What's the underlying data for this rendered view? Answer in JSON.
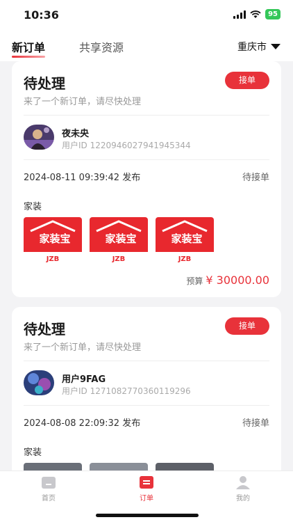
{
  "status_bar": {
    "time": "10:36",
    "battery": "95"
  },
  "header": {
    "tabs": [
      {
        "label": "新订单"
      },
      {
        "label": "共享资源"
      }
    ],
    "city": "重庆市"
  },
  "orders": [
    {
      "title": "待处理",
      "accept_label": "接单",
      "subtitle": "来了一个新订单，请尽快处理",
      "user_name": "夜未央",
      "user_id": "用户ID 1220946027941945344",
      "date": "2024-08-11 09:39:42",
      "date_suffix": "发布",
      "status": "待接单",
      "category": "家装",
      "images": [
        {
          "logo_text": "家装宝",
          "caption": "JZB"
        },
        {
          "logo_text": "家装宝",
          "caption": "JZB"
        },
        {
          "logo_text": "家装宝",
          "caption": "JZB"
        }
      ],
      "budget_label": "预算",
      "budget_value": "¥ 30000.00"
    },
    {
      "title": "待处理",
      "accept_label": "接单",
      "subtitle": "来了一个新订单，请尽快处理",
      "user_name": "用户9FAG",
      "user_id": "用户ID 1271082770360119296",
      "date": "2024-08-08 22:09:32",
      "date_suffix": "发布",
      "status": "待接单",
      "category": "家装"
    }
  ],
  "bottom_nav": [
    {
      "label": "首页",
      "icon": "home-icon"
    },
    {
      "label": "订单",
      "icon": "order-icon"
    },
    {
      "label": "我的",
      "icon": "profile-icon"
    }
  ],
  "colors": {
    "accent": "#e8323a",
    "background": "#f3f3f5"
  }
}
